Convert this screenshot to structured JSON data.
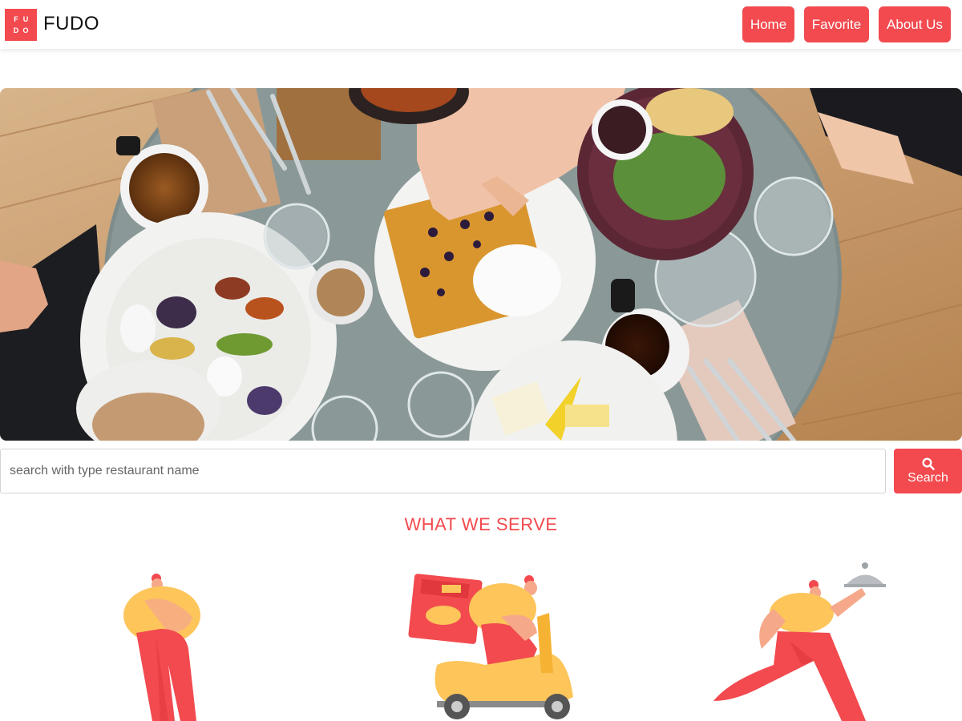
{
  "header": {
    "logo_letters": [
      "F",
      "U",
      "D",
      "O"
    ],
    "brand": "FUDO",
    "nav": {
      "home": "Home",
      "favorite": "Favorite",
      "about": "About Us"
    }
  },
  "hero": {
    "image": "restaurant-table-food-photo"
  },
  "search": {
    "placeholder": "search with type restaurant name",
    "value": "",
    "button_label": "Search",
    "icon": "search-icon"
  },
  "serve": {
    "title": "WHAT WE SERVE",
    "illustrations": [
      "cook-illustration",
      "delivery-scooter-illustration",
      "waiter-running-illustration"
    ]
  },
  "colors": {
    "accent": "#f24a4f",
    "yellow": "#fdc55a",
    "skin": "#f6a98a"
  }
}
